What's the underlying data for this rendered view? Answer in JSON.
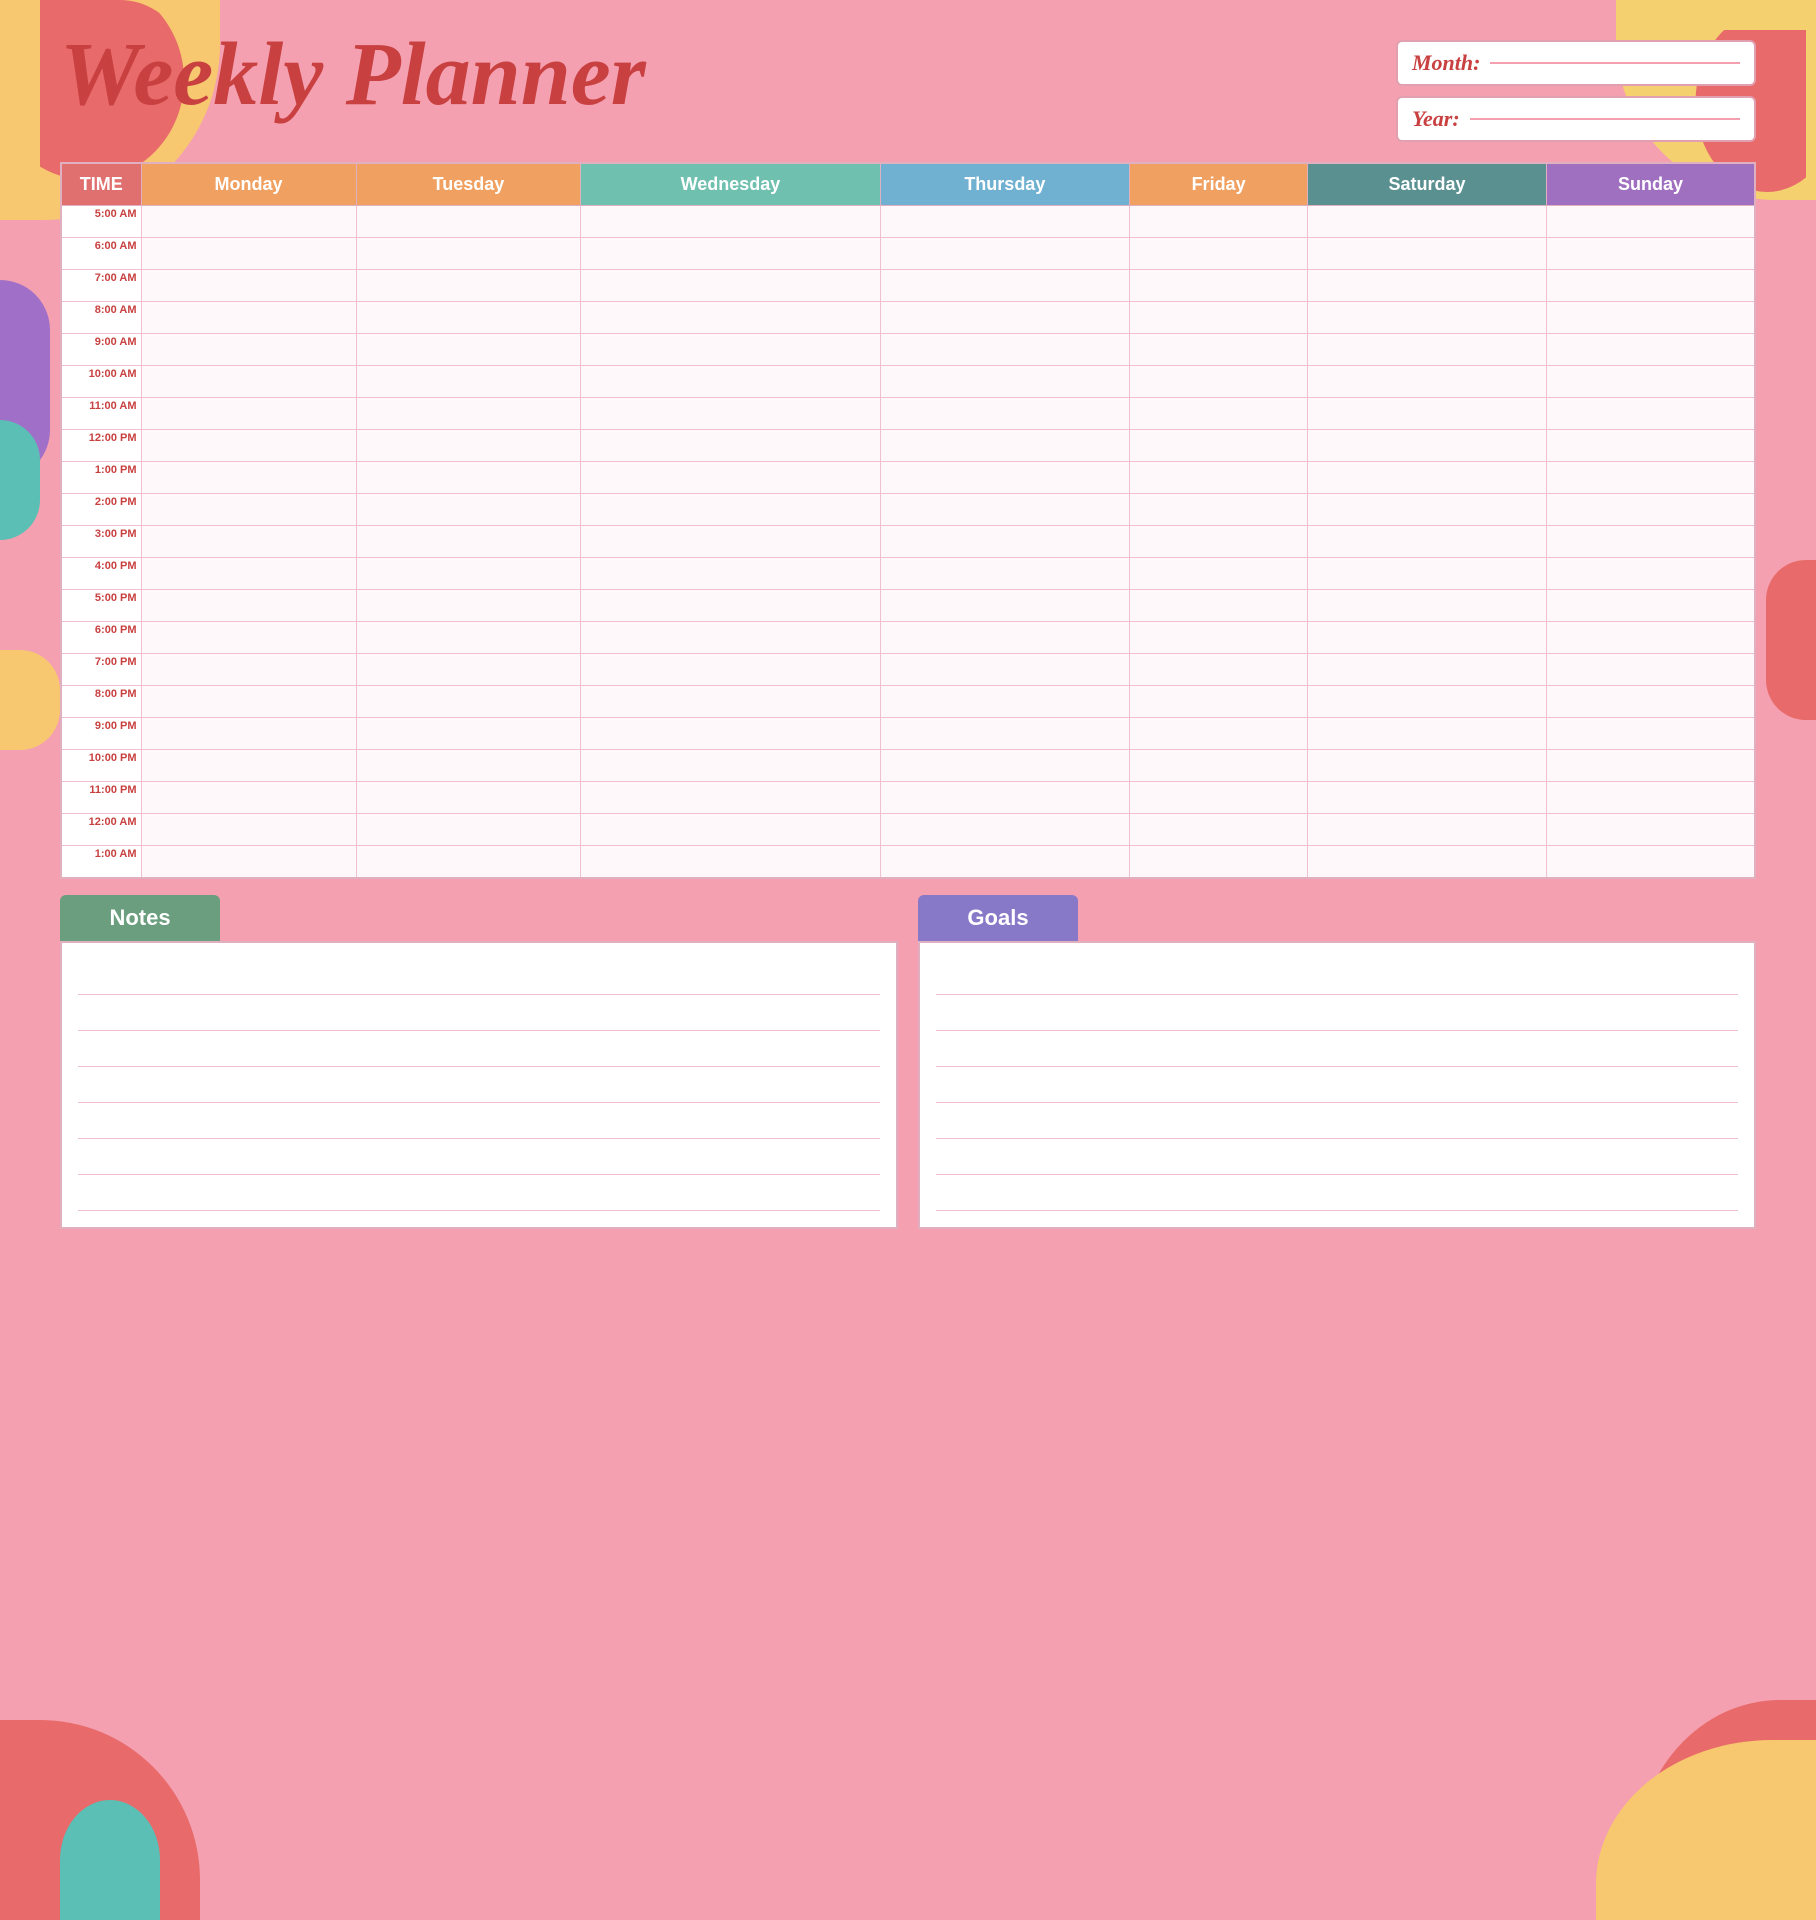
{
  "title": "Weekly Planner",
  "header": {
    "month_label": "Month:",
    "year_label": "Year:"
  },
  "days": {
    "time": "TIME",
    "monday": "Monday",
    "tuesday": "Tuesday",
    "wednesday": "Wednesday",
    "thursday": "Thursday",
    "friday": "Friday",
    "saturday": "Saturday",
    "sunday": "Sunday"
  },
  "times": [
    "5:00 AM",
    "6:00 AM",
    "7:00 AM",
    "8:00 AM",
    "9:00 AM",
    "10:00 AM",
    "11:00 AM",
    "12:00 PM",
    "1:00 PM",
    "2:00 PM",
    "3:00 PM",
    "4:00 PM",
    "5:00 PM",
    "6:00 PM",
    "7:00 PM",
    "8:00 PM",
    "9:00 PM",
    "10:00 PM",
    "11:00 PM",
    "12:00 AM",
    "1:00 AM"
  ],
  "sections": {
    "notes_label": "Notes",
    "goals_label": "Goals"
  },
  "notes_lines": [
    "",
    "",
    "",
    "",
    "",
    "",
    ""
  ],
  "goals_lines": [
    "",
    "",
    "",
    "",
    "",
    "",
    ""
  ]
}
